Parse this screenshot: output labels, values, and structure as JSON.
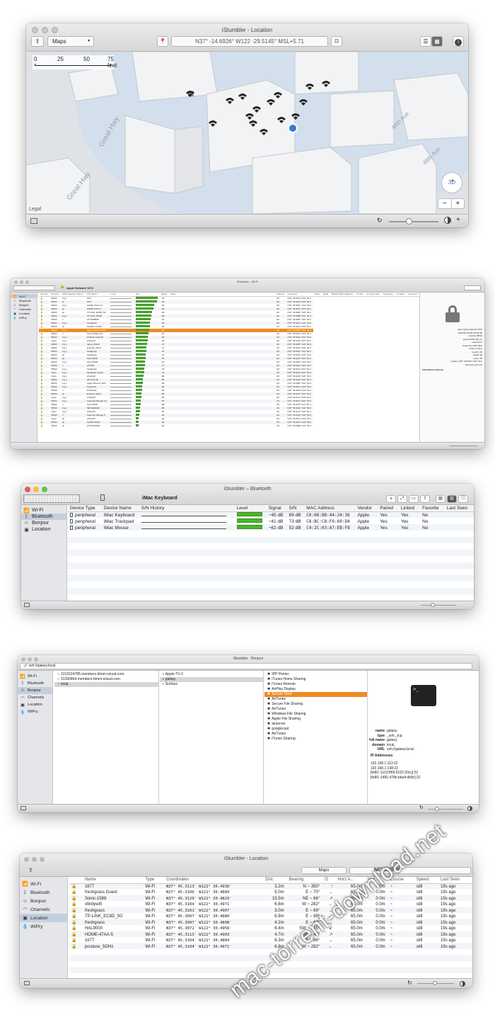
{
  "loc_window": {
    "title": "iStumbler - Location",
    "maps_label": "Maps",
    "coords": "N37° -14.6926° W122 -29.5145° MSL+5.71",
    "scale_ticks": [
      "0",
      "25",
      "50",
      "75 feet"
    ],
    "street_labels": [
      "Great Hwy",
      "Great Hwy",
      "48th Ave",
      "48th Ave"
    ],
    "compass_label": "3D",
    "legal": "Legal",
    "zoom_out": "−",
    "zoom_in": "+"
  },
  "wifi_window": {
    "title": "iStumbler - Wi-Fi",
    "network_title": "Apple Network 1672",
    "sidebar": [
      "Wi-Fi",
      "Bluetooth",
      "Bonjour",
      "Channels",
      "Location",
      "WiPry"
    ],
    "headers": [
      "Security",
      "Protocol",
      "SSID (Network Name)",
      "S/N History",
      "Level",
      "S/N",
      "Signal",
      "Noise",
      "Channel",
      "Frequency",
      "Band",
      "Width",
      "BSSID (MAC Address)",
      "Vendor",
      "Country Code",
      "Regulatory",
      "Location",
      "Last Seen"
    ],
    "rows": [
      [
        "WPA2",
        "b,g,n",
        "1677",
        "-43",
        "US",
        "N37° 45.3113 °122° 30.4"
      ],
      [
        "WPA2",
        "ac",
        "1677",
        "-46",
        "US",
        "N37° 45.3104 °122° 30.4"
      ],
      [
        "WPA2",
        "b,g,n",
        "HOME-47AA-2.4",
        "-52",
        "US",
        "N37° 45.3097 °122° 30.4"
      ],
      [
        "WPA2",
        "ac",
        "HOME-47AA-5",
        "-55",
        "US",
        "N37° 45.3112 °122° 30.4"
      ],
      [
        "WPA2",
        "ac",
        "TP-LINK_EC8D_5G",
        "-58",
        "US",
        "N37° 45.3097 °122° 30.4"
      ],
      [
        "WPA2",
        "b,g,n",
        "TP-LINK_EC8D",
        "-60",
        "US",
        "N37° 45.3088 °122° 30.4"
      ],
      [
        "WPA2",
        "n",
        "ATT4H8BKD",
        "-61",
        "US",
        "N37° 45.3087 °122° 30.4"
      ],
      [
        "WPA2",
        "b,g,n",
        "freshgrass",
        "-63",
        "US",
        "N37° 45.3101 °122° 30.4"
      ],
      [
        "WPA2",
        "ac",
        "SLAKE 2.4GHZ",
        "-64",
        "US",
        "N37° 45.3113 °122° 30.4"
      ],
      [
        "WPA2",
        "b,g,n",
        "Apple Network 1672",
        "-66",
        "US",
        "N37° 45.3097 °122° 30.4"
      ],
      [
        "WPA2",
        "n",
        "Sonic-8202 (2.4)",
        "-67",
        "US",
        "N37° 45.3112 °122° 30.4"
      ],
      [
        "WPA2",
        "b,g,n",
        "Chateau Ansarolf",
        "-69",
        "US",
        "N37° 45.3104 °122° 30.4"
      ],
      [
        "Open",
        "b,g,n",
        "xfinitywifi",
        "-70",
        "US",
        "N37° 45.3113 °122° 30.4"
      ],
      [
        "WPA2",
        "b,g,n",
        "ngtcst_2GHZ",
        "-71",
        "US",
        "N37° 45.3087 °122° 30.4"
      ],
      [
        "WPA2",
        "b,g,n",
        "jessluse_2GHz",
        "-72",
        "US",
        "N37° 45.3104 °122° 30.4"
      ],
      [
        "WPA2",
        "b,g,n",
        "freshgrass",
        "-73",
        "US",
        "N37° 45.3112 °122° 30.4"
      ],
      [
        "WPA2",
        "ac",
        "freshgrass",
        "-74",
        "US",
        "N37° 45.3101 °122° 30.4"
      ],
      [
        "WPA2",
        "ac",
        "Sonic-8202",
        "-75",
        "US",
        "N37° 45.3112 °122° 30.4"
      ],
      [
        "WPA2",
        "b,g,n",
        "Sonic-8228",
        "-76",
        "US",
        "N37° 45.3097 °122° 30.4"
      ],
      [
        "WPA2",
        "n",
        "AT7064",
        "-77",
        "US",
        "N37° 45.3122 °122° 30.4"
      ],
      [
        "WPA2",
        "b,g,n",
        "freshgrass",
        "-78",
        "US",
        "N37° 45.3113 °122° 30.4"
      ],
      [
        "Open",
        "b,g,n",
        "freshgrass Guest",
        "-79",
        "US",
        "N37° 45.3104 °122° 30.4"
      ],
      [
        "Open",
        "b,g,n",
        "xfinitywifi",
        "-80",
        "US",
        "N37° 45.3129 °122° 30.4"
      ],
      [
        "WPA2",
        "b,g,n",
        "HP-Print-2D",
        "-81",
        "US",
        "N37° 45.3104 °122° 30.4"
      ],
      [
        "WPA2",
        "b,g,n",
        "Apple Network 1672",
        "-82",
        "US",
        "N37° 45.3087 °122° 30.4"
      ],
      [
        "WPA2",
        "b,g,n",
        "ToastyNet",
        "-83",
        "US",
        "N37° 45.3101 °122° 30.4"
      ],
      [
        "WPA2",
        "n",
        "Portlandia",
        "-84",
        "US",
        "N37° 45.3104 °122° 30.4"
      ],
      [
        "WPA2",
        "ac",
        "jessluse_5GHz",
        "-85",
        "US",
        "N37° 45.3113 °122° 30.4"
      ],
      [
        "Open",
        "b,g,n",
        "xfinitywifi",
        "-86",
        "US",
        "N37° 45.3127 °122° 30.4"
      ],
      [
        "WPA2",
        "b,g,n",
        "Casa De Monago 2.4",
        "-87",
        "US",
        "N37° 45.3127 °122° 30.4"
      ],
      [
        "WPA2",
        "n",
        "Sonic-8302",
        "-88",
        "US",
        "N37° 45.3115 °122° 30.4"
      ],
      [
        "WPA2",
        "b,g,n",
        "NETGEAR49",
        "-89",
        "US",
        "N37° 45.3122 °122° 30.4"
      ],
      [
        "Open",
        "b,g,n",
        "xfinitywifi",
        "-90",
        "US",
        "N37° 45.3112 °122° 30.4"
      ],
      [
        "WPA2",
        "n",
        "Casa De Monago 5",
        "-91",
        "US",
        "N37° 45.3122 °122° 30.4"
      ],
      [
        "Open",
        "ac",
        "xfinitywifi",
        "-92",
        "US",
        "N37° 45.3101 °122° 30.4"
      ],
      [
        "WPA2",
        "ac",
        "SLAKE 5GHZ",
        "-93",
        "US",
        "N37° 45.3104 °122° 30.4"
      ],
      [
        "WPA2",
        "ac",
        "ATT4U9J5HE",
        "-94",
        "US",
        "N37° 45.3088 °122° 30.4"
      ]
    ],
    "selected_row": 9,
    "info_lines": [
      "name Apple Network 1672",
      "bssid 8A-d0-A0-1D-35-6E",
      "security WPA2",
      "protocol 802.11b,g,n",
      "channel 11",
      "frequency 2462 MHz",
      "band 2.4 GHz",
      "country US",
      "signal -66",
      "noise -95",
      "location N37° 45.3097 °122° 30.4",
      "last seen just now"
    ],
    "info_heading": "Information elements"
  },
  "bt_window": {
    "title": "iStumbler – Bluetooth",
    "selected_name": "iMac Keyboard",
    "sidebar": [
      "Wi-Fi",
      "Bluetooth",
      "Bonjour",
      "Location"
    ],
    "headers": [
      "Device Type",
      "Device Name",
      "S/N History",
      "Level",
      "Signal",
      "S/N",
      "MAC Address",
      "Vendor",
      "Paired",
      "Linked",
      "Favorite",
      "Last Seen"
    ],
    "rows": [
      {
        "type": "peripheral",
        "name": "iMac Keyboard",
        "signal": "−45 dB",
        "sn": "69 dB",
        "mac": "C0:06:88:44:24:36",
        "vendor": "Apple",
        "paired": "Yes",
        "linked": "Yes",
        "favorite": "No"
      },
      {
        "type": "peripheral",
        "name": "iMac Trackpad",
        "signal": "−41 dB",
        "sn": "73 dB",
        "mac": "C8:BC:C8:F6:60:D4",
        "vendor": "Apple",
        "paired": "Yes",
        "linked": "Yes",
        "favorite": "No"
      },
      {
        "type": "peripheral",
        "name": "iMac Mouse",
        "signal": "−62 dB",
        "sn": "52 dB",
        "mac": "C4:2C:03:A7:EB:F8",
        "vendor": "Apple",
        "paired": "Yes",
        "linked": "Yes",
        "favorite": "No"
      }
    ]
  },
  "bonjour_window": {
    "title": "iStumbler - Bonjour",
    "url": "ssh://galaxy.local.",
    "sidebar": [
      "Wi-Fi",
      "Bluetooth",
      "Bonjour",
      "Channels",
      "Location",
      "WiPry"
    ],
    "col1": [
      "1313124785.members.btmm.icloud.com.",
      "91266864.members.btmm.icloud.com.",
      "local."
    ],
    "col2": [
      "Apple-TV-3",
      "galaxy",
      "Surface"
    ],
    "col3": [
      "IPP Printer",
      "iTunes Home Sharing",
      "iTunes Remote",
      "AirPlay Display",
      "Secure Shell",
      "AirTunes",
      "Secure File Sharing",
      "AirTunes",
      "Windows File Sharing",
      "Apple File Sharing",
      "airserver",
      "googlecast",
      "AirTunes",
      "iTunes Sharing"
    ],
    "info": [
      {
        "k": "name",
        "v": "galaxy"
      },
      {
        "k": "type",
        "v": "_ssh._tcp."
      },
      {
        "k": "full name",
        "v": "galaxy"
      },
      {
        "k": "domain",
        "v": "local."
      },
      {
        "k": "URL",
        "v": "ssh://galaxy.local."
      }
    ],
    "ip_heading": "IP Addresses",
    "ips": [
      "192.168.1.113:22",
      "192.168.1.138:22",
      "[fe80::1c03:ff65:6162:20cc]:22",
      "[fe80::1481:478e:bba4:db8c]:22"
    ],
    "terminal_prompt": ">_"
  },
  "loc2_window": {
    "title": "iStumbler - Location",
    "maps_label": "Maps",
    "coord_field": "N0° 0.0000°",
    "sidebar": [
      "Wi-Fi",
      "Bluetooth",
      "Bonjour",
      "Channels",
      "Location",
      "WiPry"
    ],
    "headers": [
      "Name",
      "Type",
      "Coordinates",
      "Dist.",
      "Bearing",
      "O",
      "Horz A...",
      "Vert...",
      "Course",
      "Speed",
      "Last Seen"
    ],
    "rows": [
      [
        "1677",
        "Wi-Fi",
        "N37° 45.3113′ W122° 30.4930′",
        "3.2m",
        "N ~ 350°",
        "↑",
        "65.0m",
        "0.0m",
        "~",
        "still",
        "19s ago"
      ],
      [
        "freshgrass Guest",
        "Wi-Fi",
        "N37° 45.3106′ W122° 30.4889′",
        "5.0m",
        "E ~ 70°",
        "→",
        "65.0m",
        "0.0m",
        "~",
        "still",
        "19s ago"
      ],
      [
        "Sonic-1588",
        "Wi-Fi",
        "N37° 45.3129′ W122° 30.4829′",
        "15.5m",
        "NE ~ 66°",
        "↗",
        "65.0m",
        "0.0m",
        "~",
        "still",
        "19s ago"
      ],
      [
        "xfinitywifi",
        "Wi-Fi",
        "N37° 45.3104′ W122° 30.4971′",
        "6.8m",
        "W ~ 282°",
        "←",
        "65.0m",
        "0.0m",
        "~",
        "still",
        "19s ago"
      ],
      [
        "freshgrass",
        "Wi-Fi",
        "N37° 45.3101′ W122° 30.4907′",
        "3.0m",
        "E ~ 69°",
        "→",
        "65.0m",
        "0.0m",
        "~",
        "still",
        "19s ago"
      ],
      [
        "TP-LINK_EC8D_5G",
        "Wi-Fi",
        "N37° 45.3097′ W122° 30.4880′",
        "6.9m",
        "E ~ 88°",
        "→",
        "65.0m",
        "0.0m",
        "~",
        "still",
        "19s ago"
      ],
      [
        "freshgrass",
        "Wi-Fi",
        "N37° 45.3097′ W122° 30.4898′",
        "4.2m",
        "E ~ 87°",
        "→",
        "65.0m",
        "0.0m",
        "~",
        "still",
        "19s ago"
      ],
      [
        "HAL9000",
        "Wi-Fi",
        "N37° 45.3072′ W122° 30.4958′",
        "6.4m",
        "SW ~ 225°",
        "↙",
        "65.0m",
        "0.0m",
        "~",
        "still",
        "19s ago"
      ],
      [
        "HOME-47AA-5",
        "Wi-Fi",
        "N37° 45.3113′ W122° 30.4903′",
        "4.7m",
        "NE ~ 47°",
        "↗",
        "65.0m",
        "0.0m",
        "~",
        "still",
        "19s ago"
      ],
      [
        "1677",
        "Wi-Fi",
        "N37° 45.3104′ W122° 30.4884′",
        "6.3m",
        "E ~ 86°",
        "→",
        "65.0m",
        "0.0m",
        "~",
        "still",
        "19s ago"
      ],
      [
        "jessluse_5GHz",
        "Wi-Fi",
        "N37° 45.3104′ W122° 30.4971′",
        "6.8m",
        "W ~ 282°",
        "←",
        "65.0m",
        "0.0m",
        "~",
        "still",
        "19s ago"
      ]
    ]
  },
  "watermark": "mac-torrent-download.net",
  "colors": {
    "selection": "#f08a24",
    "level_green": "#4fbf2f",
    "sidebar_sel": "#c5cfdc",
    "map_bg": "#dfe3e8",
    "accent_blue": "#2f7dd6"
  }
}
